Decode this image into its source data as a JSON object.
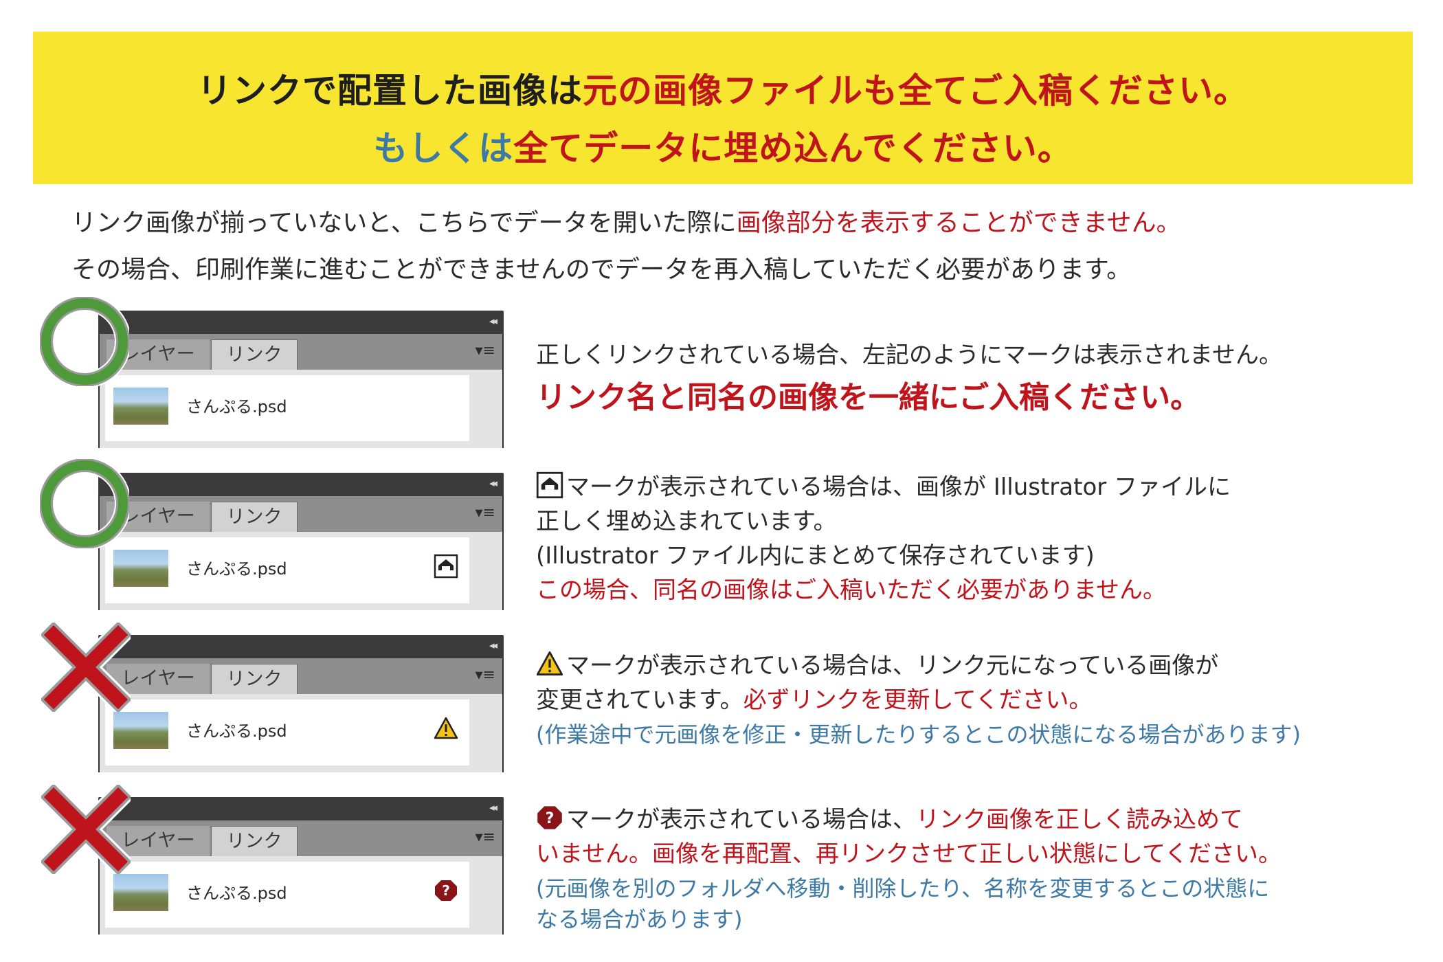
{
  "banner": {
    "line1_a": "リンクで配置した画像は",
    "line1_b": "元の画像ファイルも全てご入稿ください。",
    "line2_a": "もしくは",
    "line2_b": "全てデータに埋め込んでください。"
  },
  "intro": {
    "line1_a": "リンク画像が揃っていないと、こちらでデータを開いた際に",
    "line1_b": "画像部分を表示することができません。",
    "line2": "その場合、印刷作業に進むことができませんのでデータを再入稿していただく必要があります。"
  },
  "panel": {
    "tab_layer": "レイヤー",
    "tab_link": "リンク",
    "collapse": "◂◂",
    "menu": "▾≡",
    "filename": "さんぷる.psd"
  },
  "cases": [
    {
      "mark": "ok-circle",
      "status_icon": "none",
      "line1": "正しくリンクされている場合、左記のようにマークは表示されません。",
      "line2": "リンク名と同名の画像を一緒にご入稿ください。"
    },
    {
      "mark": "ok-circle",
      "status_icon": "embedded-icon",
      "line1": "マークが表示されている場合は、画像が Illustrator ファイルに",
      "line2": "正しく埋め込まれています。",
      "line3": "(Illustrator ファイル内にまとめて保存されています)",
      "line4": "この場合、同名の画像はご入稿いただく必要がありません。"
    },
    {
      "mark": "ng-cross",
      "status_icon": "warning-icon",
      "line1": "マークが表示されている場合は、リンク元になっている画像が",
      "line2_a": "変更されています。",
      "line2_b": "必ずリンクを更新してください。",
      "line3": "(作業途中で元画像を修正・更新したりするとこの状態になる場合があります)"
    },
    {
      "mark": "ng-cross",
      "status_icon": "missing-link-icon",
      "line1_a": "マークが表示されている場合は、",
      "line1_b": "リンク画像を正しく読み込めて",
      "line2": "いません。画像を再配置、再リンクさせて正しい状態にしてください。",
      "line3": "(元画像を別のフォルダへ移動・削除したり、名称を変更するとこの状態に",
      "line4": " なる場合があります)"
    }
  ],
  "colors": {
    "banner_bg": "#f7e52f",
    "accent_red": "#c0141c",
    "accent_blue": "#3d79a6",
    "ok_green": "#4e9a3a",
    "ng_red": "#c0141c"
  }
}
